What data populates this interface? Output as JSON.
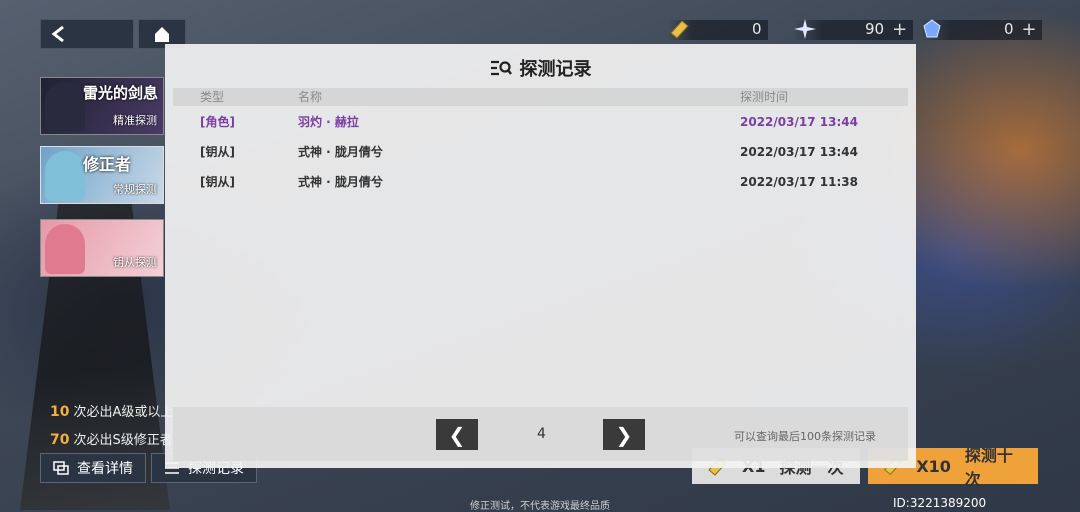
{
  "resources": [
    {
      "icon": "ticket-icon",
      "value": "0",
      "plus": ""
    },
    {
      "icon": "crystal-shard-icon",
      "value": "90",
      "plus": "+"
    },
    {
      "icon": "blue-crystal-icon",
      "value": "0",
      "plus": "+"
    }
  ],
  "banners": [
    {
      "title": "雷光的剑息",
      "sub": "精准探测"
    },
    {
      "title": "修正者",
      "sub": "常规探测"
    },
    {
      "title": "",
      "sub": "钥从探测"
    }
  ],
  "guarantees": [
    {
      "count": "10",
      "text": "次必出A级或以上"
    },
    {
      "count": "70",
      "text": "次必出S级修正者"
    }
  ],
  "bottom_buttons": {
    "details": "查看详情",
    "records": "探测记录",
    "draw1_count": "X1",
    "draw1_label": "探测一次",
    "draw10_count": "X10",
    "draw10_label": "探测十次"
  },
  "player_id": "ID:3221389200",
  "disclaimer": "修正测试，不代表游戏最终品质",
  "modal": {
    "title": "探测记录",
    "headers": {
      "type": "类型",
      "name": "名称",
      "time": "探测时间"
    },
    "rows": [
      {
        "type": "[角色]",
        "name": "羽灼 · 赫拉",
        "time": "2022/03/17 13:44"
      },
      {
        "type": "[钥从]",
        "name": "式神 · 胧月倩兮",
        "time": "2022/03/17 13:44"
      },
      {
        "type": "[钥从]",
        "name": "式神 · 胧月倩兮",
        "time": "2022/03/17 11:38"
      }
    ],
    "prev": "❮",
    "next": "❯",
    "page": "4",
    "note": "可以查询最后100条探测记录"
  },
  "colors": {
    "character_row": "#7a3fa0",
    "draw10_bg": "#f0a23a",
    "guarantee_count": "#f0b040"
  }
}
